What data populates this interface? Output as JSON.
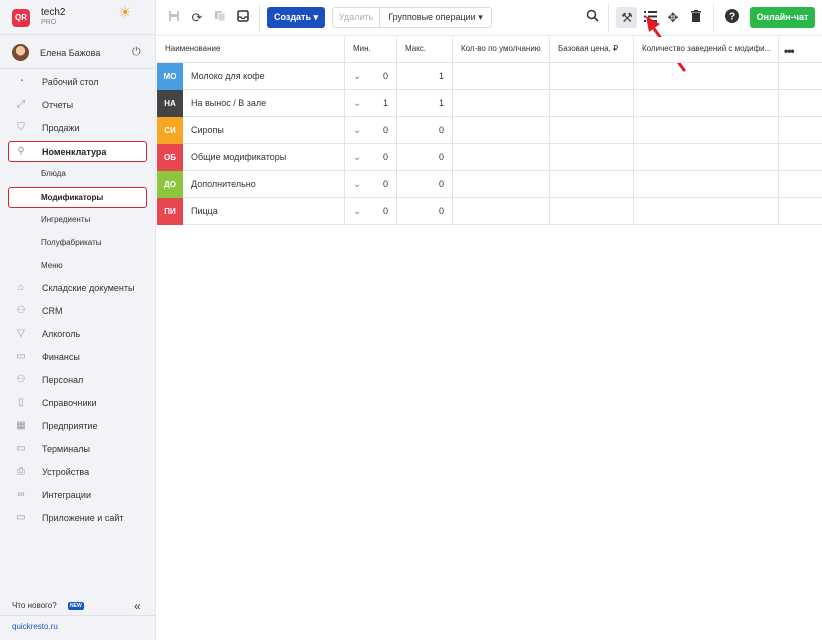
{
  "brand": {
    "logo": "QR",
    "name": "tech2",
    "plan": "PRO"
  },
  "user": {
    "name": "Елена Бажова"
  },
  "nav": {
    "items": [
      {
        "label": "Рабочий стол",
        "icon": "dashboard-icon",
        "glyph": "◔"
      },
      {
        "label": "Отчеты",
        "icon": "reports-icon",
        "glyph": "⤢"
      },
      {
        "label": "Продажи",
        "icon": "basket-icon",
        "glyph": "⛉"
      },
      {
        "label": "Номенклатура",
        "icon": "link-icon",
        "glyph": "⚲"
      },
      {
        "label": "Складские документы",
        "icon": "warehouse-icon",
        "glyph": "⌂"
      },
      {
        "label": "CRM",
        "icon": "crm-icon",
        "glyph": "⚇"
      },
      {
        "label": "Алкоголь",
        "icon": "glass-icon",
        "glyph": "▽"
      },
      {
        "label": "Финансы",
        "icon": "wallet-icon",
        "glyph": "▭"
      },
      {
        "label": "Персонал",
        "icon": "people-icon",
        "glyph": "⚇"
      },
      {
        "label": "Справочники",
        "icon": "book-icon",
        "glyph": "▯"
      },
      {
        "label": "Предприятие",
        "icon": "building-icon",
        "glyph": "▦"
      },
      {
        "label": "Терминалы",
        "icon": "terminal-icon",
        "glyph": "▭"
      },
      {
        "label": "Устройства",
        "icon": "printer-icon",
        "glyph": "⎙"
      },
      {
        "label": "Интеграции",
        "icon": "infinity-icon",
        "glyph": "∞"
      },
      {
        "label": "Приложение и сайт",
        "icon": "app-icon",
        "glyph": "▭"
      }
    ],
    "sub": [
      "Блюда",
      "Модификаторы",
      "Ингредиенты",
      "Полуфабрикаты",
      "Меню"
    ]
  },
  "footer": {
    "whats_new": "Что нового?",
    "new_badge": "NEW",
    "site": "quickresto.ru"
  },
  "toolbar": {
    "create": "Создать",
    "delete": "Удалить",
    "group_ops": "Групповые операции",
    "chat": "Онлайн-чат"
  },
  "table": {
    "headers": [
      "Наименование",
      "Мин.",
      "Макс.",
      "Кол-во по умолчанию",
      "Базовая цена, ₽",
      "Количество заведений с модифи..."
    ],
    "rows": [
      {
        "badge": "МО",
        "color": "#4a9de0",
        "name": "Молоко для кофе",
        "min": "0",
        "max": "1"
      },
      {
        "badge": "НА",
        "color": "#444444",
        "name": "На вынос / В зале",
        "min": "1",
        "max": "1"
      },
      {
        "badge": "СИ",
        "color": "#f5a623",
        "name": "Сиропы",
        "min": "0",
        "max": "0"
      },
      {
        "badge": "ОБ",
        "color": "#e8474f",
        "name": "Общие модификаторы",
        "min": "0",
        "max": "0"
      },
      {
        "badge": "ДО",
        "color": "#8cc63f",
        "name": "Дополнительно",
        "min": "0",
        "max": "0"
      },
      {
        "badge": "ПИ",
        "color": "#e8474f",
        "name": "Пицца",
        "min": "0",
        "max": "0"
      }
    ]
  }
}
